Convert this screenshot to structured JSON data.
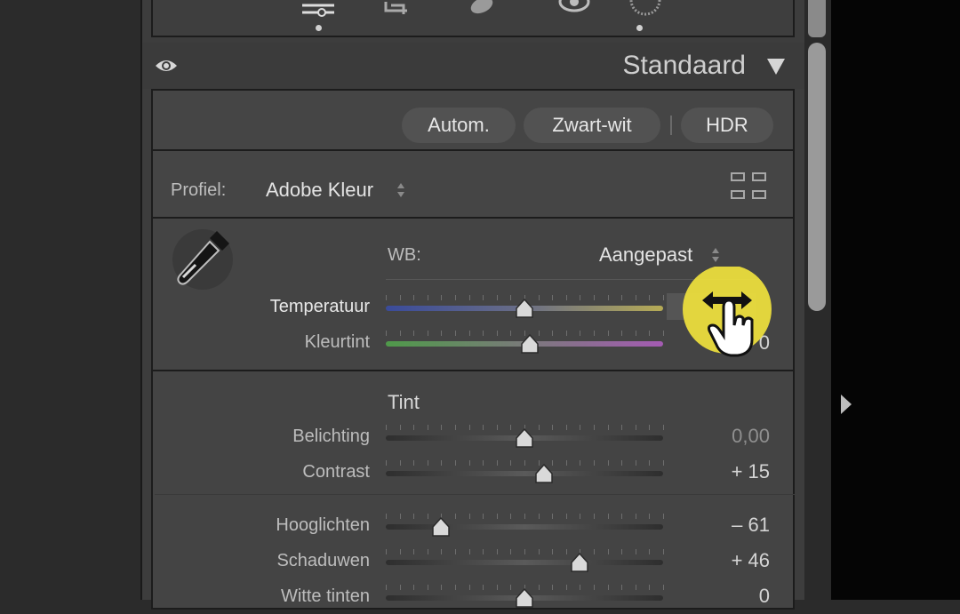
{
  "toolbar": {
    "icons": [
      "sliders-icon",
      "crop-icon",
      "healing-icon",
      "redeye-icon",
      "mask-icon"
    ]
  },
  "header": {
    "title": "Standaard"
  },
  "buttons": {
    "auto": "Autom.",
    "bw": "Zwart-wit",
    "hdr": "HDR"
  },
  "profile": {
    "label": "Profiel:",
    "value": "Adobe Kleur"
  },
  "wb": {
    "label": "WB:",
    "value": "Aangepast",
    "temperature": {
      "label": "Temperatuur",
      "value": "",
      "position": 0.5
    },
    "tint": {
      "label": "Kleurtint",
      "value": "0",
      "position": 0.52
    }
  },
  "tone": {
    "heading": "Tint",
    "sliders": [
      {
        "label": "Belichting",
        "value": "0,00",
        "position": 0.5
      },
      {
        "label": "Contrast",
        "value": "+ 15",
        "position": 0.57
      },
      {
        "label": "Hooglichten",
        "value": "– 61",
        "position": 0.2
      },
      {
        "label": "Schaduwen",
        "value": "+ 46",
        "position": 0.7
      },
      {
        "label": "Witte tinten",
        "value": "0",
        "position": 0.5
      }
    ]
  },
  "colors": {
    "accent_cursor": "#f3e33b",
    "panel_bg": "#444444"
  }
}
